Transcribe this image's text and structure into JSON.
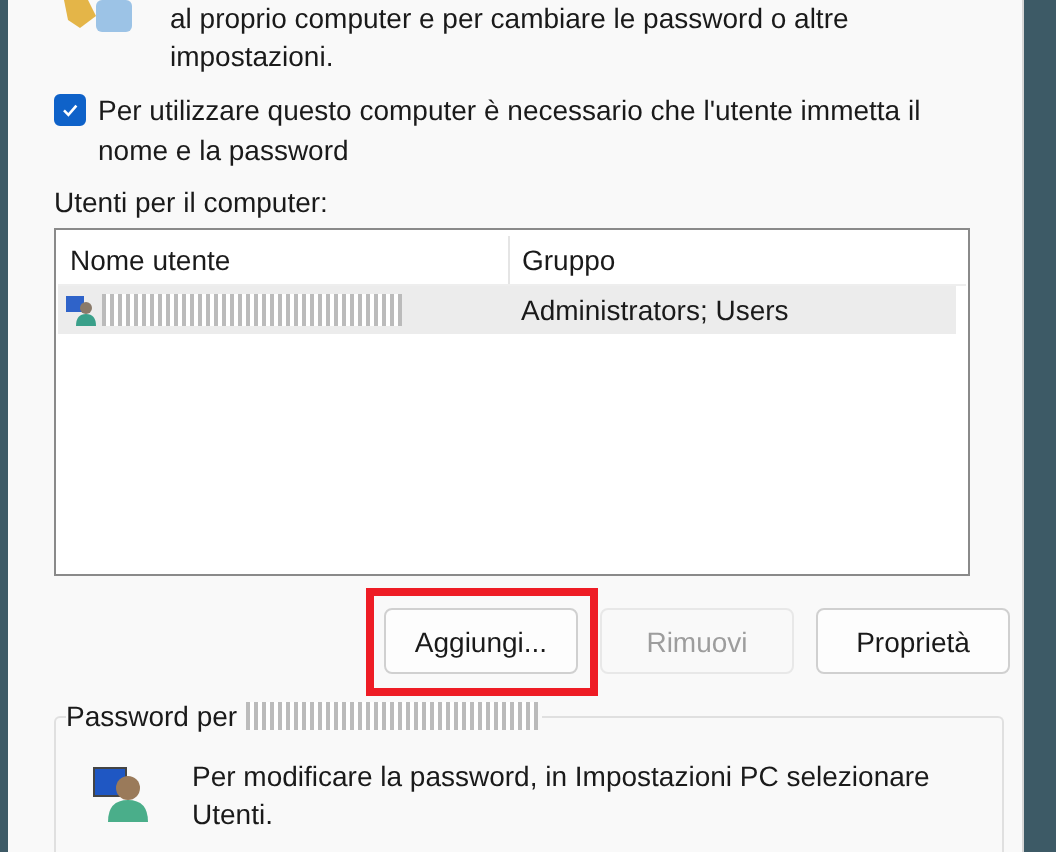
{
  "intro": {
    "lines": [
      "al proprio computer e per cambiare le password o altre",
      "impostazioni."
    ]
  },
  "require_login": {
    "label": "Per utilizzare questo computer è necessario che l'utente immetta il nome e la password",
    "checked": true
  },
  "users": {
    "label": "Utenti per il computer:",
    "columns": [
      "Nome utente",
      "Gruppo"
    ],
    "rows": [
      {
        "group": "Administrators; Users",
        "selected": true
      }
    ]
  },
  "buttons": [
    {
      "label": "Aggiungi...",
      "disabled": false,
      "highlighted": true
    },
    {
      "label": "Rimuovi",
      "disabled": true,
      "highlighted": false
    },
    {
      "label": "Proprietà",
      "disabled": false,
      "highlighted": false
    }
  ],
  "password_group": {
    "legend": "Password per",
    "text": "Per modificare la password, in Impostazioni PC selezionare Utenti."
  }
}
